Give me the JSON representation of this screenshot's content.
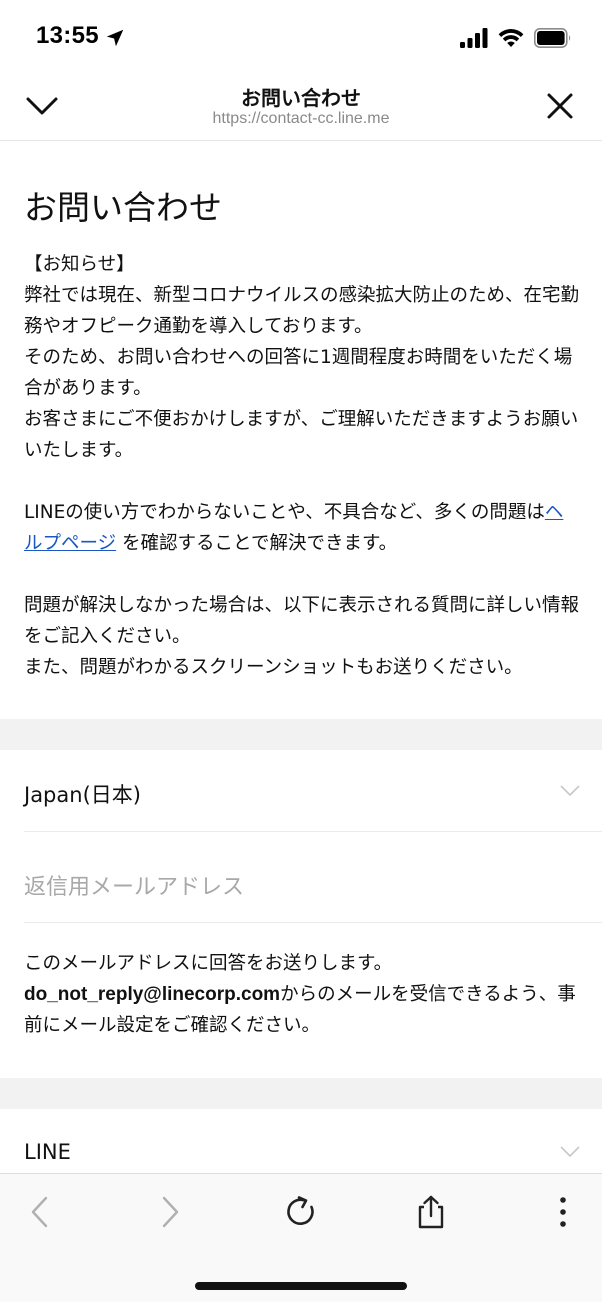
{
  "status_bar": {
    "time": "13:55",
    "location_icon": "location-arrow-icon",
    "signal_icon": "cellular-signal-icon",
    "wifi_icon": "wifi-icon",
    "battery_icon": "battery-icon"
  },
  "browser_header": {
    "title": "お問い合わせ",
    "url": "https://contact-cc.line.me",
    "collapse_icon": "chevron-down-icon",
    "close_icon": "close-icon"
  },
  "page": {
    "title": "お問い合わせ",
    "notice": {
      "heading": "【お知らせ】",
      "body": "弊社では現在、新型コロナウイルスの感染拡大防止のため、在宅勤務やオフピーク通勤を導入しております。\nそのため、お問い合わせへの回答に1週間程度お時間をいただく場合があります。\nお客さまにご不便おかけしますが、ご理解いただきますようお願いいたします。"
    },
    "help_text": {
      "before_link": "LINEの使い方でわからないことや、不具合など、多くの問題は",
      "link_label": "ヘルプページ",
      "after_link": " を確認することで解決できます。"
    },
    "instructions": "問題が解決しなかった場合は、以下に表示される質問に詳しい情報をご記入ください。\nまた、問題がわかるスクリーンショットもお送りください。"
  },
  "form": {
    "country_select": {
      "value": "Japan(日本)"
    },
    "email_input": {
      "placeholder": "返信用メールアドレス"
    },
    "email_note": {
      "line1": "このメールアドレスに回答をお送りします。",
      "sender": "do_not_reply@linecorp.com",
      "after_sender": "からのメールを受信できるよう、事前にメール設定をご確認ください。"
    },
    "service_select": {
      "value": "LINE"
    }
  },
  "toolbar": {
    "back_icon": "chevron-left-icon",
    "forward_icon": "chevron-right-icon",
    "reload_icon": "reload-icon",
    "share_icon": "share-icon",
    "more_icon": "more-vertical-icon"
  },
  "colors": {
    "link": "#1a56c4",
    "placeholder": "#a8a8a8",
    "band": "#f2f2f2",
    "url": "#8a8a8a"
  }
}
